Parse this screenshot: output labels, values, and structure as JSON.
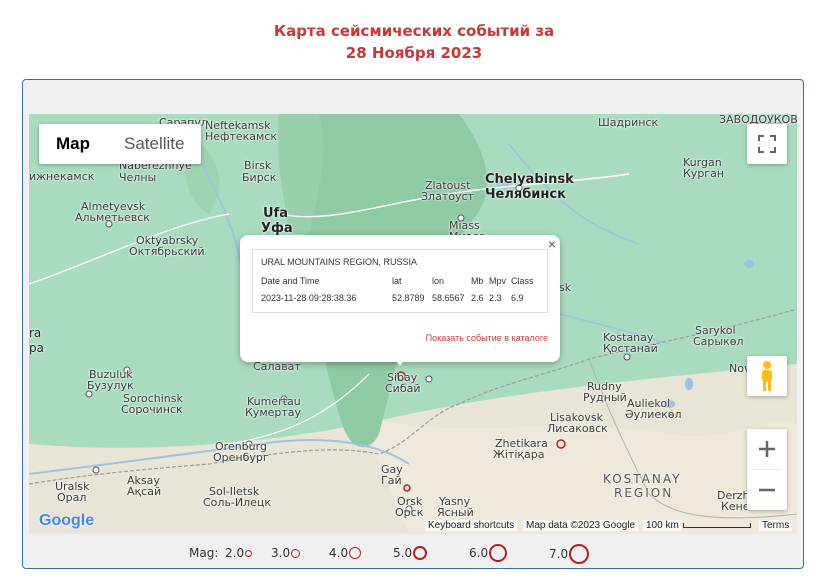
{
  "header": {
    "title_line1": "Карта сейсмических событий за",
    "title_line2": "28 Ноября 2023"
  },
  "map_type": {
    "map_label": "Map",
    "satellite_label": "Satellite"
  },
  "labels": [
    {
      "id": "sarapul",
      "text": "Сарапул"
    },
    {
      "id": "neftekamsk",
      "text": "Neftekamsk"
    },
    {
      "id": "neftekamsk_ru",
      "text": "Нефтекамск"
    },
    {
      "id": "nizhnekamsk",
      "text": "ижнекамск"
    },
    {
      "id": "naberezhnye",
      "text": "Naberezhnye"
    },
    {
      "id": "chelny",
      "text": "Челны"
    },
    {
      "id": "birsk",
      "text": "Birsk"
    },
    {
      "id": "birsk_ru",
      "text": "Бирск"
    },
    {
      "id": "almetyevsk",
      "text": "Almetyevsk"
    },
    {
      "id": "almetyevsk_ru",
      "text": "Альметьевск"
    },
    {
      "id": "ufa",
      "text": "Ufa"
    },
    {
      "id": "ufa_ru",
      "text": "Уфа"
    },
    {
      "id": "oktyabrsky",
      "text": "Oktyabrsky"
    },
    {
      "id": "oktyabrsky_ru",
      "text": "Октябрьский"
    },
    {
      "id": "zlatoust",
      "text": "Zlatoust"
    },
    {
      "id": "zlatoust_ru",
      "text": "Златоуст"
    },
    {
      "id": "chelyabinsk",
      "text": "Chelyabinsk"
    },
    {
      "id": "chelyabinsk_ru",
      "text": "Челябинск"
    },
    {
      "id": "miass",
      "text": "Miass"
    },
    {
      "id": "miass_ru",
      "text": "Миасс"
    },
    {
      "id": "shadrinsk",
      "text": "Шадринск"
    },
    {
      "id": "zavodoukovsk",
      "text": "ЗАВОДОУКОВСК"
    },
    {
      "id": "kurgan",
      "text": "Kurgan"
    },
    {
      "id": "kurgan_ru",
      "text": "Курган"
    },
    {
      "id": "ra",
      "text": "ra"
    },
    {
      "id": "ra2",
      "text": "ра"
    },
    {
      "id": "buzuluk",
      "text": "Buzuluk"
    },
    {
      "id": "buzuluk_ru",
      "text": "Бузулук"
    },
    {
      "id": "salavat",
      "text": "Салават"
    },
    {
      "id": "sorochinsk",
      "text": "Sorochinsk"
    },
    {
      "id": "sorochinsk_ru",
      "text": "Сорочинск"
    },
    {
      "id": "kumertau",
      "text": "Kumertau"
    },
    {
      "id": "kumertau_ru",
      "text": "Кумертау"
    },
    {
      "id": "sibay",
      "text": "Sibay"
    },
    {
      "id": "sibay_ru",
      "text": "Сибай"
    },
    {
      "id": "kartaly",
      "text": "sk"
    },
    {
      "id": "kostanay",
      "text": "Kostanay"
    },
    {
      "id": "kostanay_kz",
      "text": "Қостанай"
    },
    {
      "id": "sarykol",
      "text": "Sarykol"
    },
    {
      "id": "sarykol_kz",
      "text": "Сарыкөл"
    },
    {
      "id": "rudny",
      "text": "Rudny"
    },
    {
      "id": "rudny_ru",
      "text": "Рудный"
    },
    {
      "id": "auliekol",
      "text": "Auliekol"
    },
    {
      "id": "auliekol_kz",
      "text": "Әулиекөл"
    },
    {
      "id": "lisakovsk",
      "text": "Lisakovsk"
    },
    {
      "id": "lisakovsk_ru",
      "text": "Лисаковск"
    },
    {
      "id": "orenburg",
      "text": "Orenburg"
    },
    {
      "id": "orenburg_ru",
      "text": "Оренбург"
    },
    {
      "id": "zhetikara",
      "text": "Zhetikara"
    },
    {
      "id": "zhetikara_kz",
      "text": "Жітіқара"
    },
    {
      "id": "gay",
      "text": "Gay"
    },
    {
      "id": "gay_ru",
      "text": "Гай"
    },
    {
      "id": "uralsk",
      "text": "Uralsk"
    },
    {
      "id": "oral",
      "text": "Орал"
    },
    {
      "id": "aksay",
      "text": "Aksay"
    },
    {
      "id": "aksay_kz",
      "text": "Ақсай"
    },
    {
      "id": "solietsk",
      "text": "Sol-Iletsk"
    },
    {
      "id": "solietsk_ru",
      "text": "Соль-Илецк"
    },
    {
      "id": "orsk",
      "text": "Orsk"
    },
    {
      "id": "orsk_ru",
      "text": "Орск"
    },
    {
      "id": "yasny",
      "text": "Yasny"
    },
    {
      "id": "yasny_ru",
      "text": "Ясный"
    },
    {
      "id": "kostanay_region",
      "text": "KOSTANAY"
    },
    {
      "id": "kostanay_region2",
      "text": "REGION"
    },
    {
      "id": "derzh",
      "text": "Derzh"
    },
    {
      "id": "derzh_ru",
      "text": "Кене"
    },
    {
      "id": "nov",
      "text": "Nov"
    }
  ],
  "popup": {
    "region": "URAL MOUNTAINS REGION, RUSSIA",
    "headers": [
      "Date and Time",
      "lat",
      "lon",
      "Mb",
      "Mpv",
      "Class"
    ],
    "values": [
      "2023-11-28 09:28:38.36",
      "52.8789",
      "58.6567",
      "2.6",
      "2.3",
      "6.9"
    ],
    "link": "Показать событие в каталоге"
  },
  "attribution": {
    "logo": "Google",
    "shortcuts": "Keyboard shortcuts",
    "mapdata": "Map data ©2023 Google",
    "scale": "100 km",
    "terms": "Terms"
  },
  "legend": {
    "label": "Mag:",
    "items": [
      "2.0",
      "3.0",
      "4.0",
      "5.0",
      "6.0",
      "7.0"
    ]
  },
  "colors": {
    "title": "#c8373a",
    "marker": "#b22222",
    "panel_border": "#3b6ea5"
  }
}
